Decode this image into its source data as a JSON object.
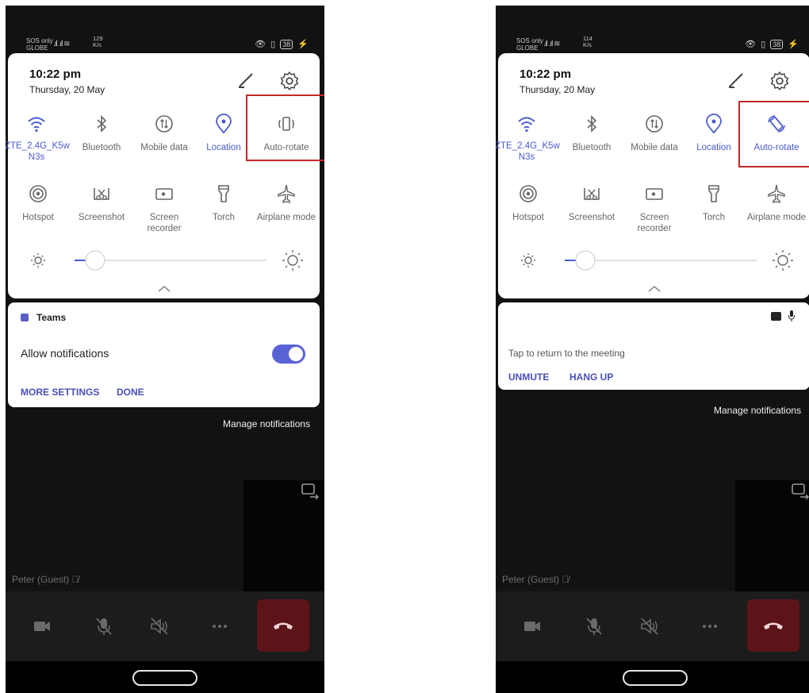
{
  "status_bar": {
    "sos": "SOS only",
    "carrier": "GLOBE",
    "left_speed": "129",
    "right_speed": "114",
    "speed_unit": "K/s",
    "battery": "38"
  },
  "quick_settings": {
    "time": "10:22 pm",
    "date": "Thursday, 20 May",
    "tiles": [
      {
        "label": "ZTE_2.4G_K5w N3s",
        "icon": "wifi-icon",
        "active": true
      },
      {
        "label": "Bluetooth",
        "icon": "bluetooth-icon",
        "active": false
      },
      {
        "label": "Mobile data",
        "icon": "mobile-data-icon",
        "active": false
      },
      {
        "label": "Location",
        "icon": "location-icon",
        "active": true
      },
      {
        "label": "Auto-rotate",
        "icon": "auto-rotate-icon",
        "active": false
      },
      {
        "label": "Hotspot",
        "icon": "hotspot-icon",
        "active": false
      },
      {
        "label": "Screenshot",
        "icon": "screenshot-icon",
        "active": false
      },
      {
        "label": "Screen recorder",
        "icon": "screen-recorder-icon",
        "active": false
      },
      {
        "label": "Torch",
        "icon": "torch-icon",
        "active": false
      },
      {
        "label": "Airplane mode",
        "icon": "airplane-icon",
        "active": false
      }
    ],
    "brightness": 0.1,
    "auto_rotate_active_right": true
  },
  "left_notification": {
    "app": "Teams",
    "allow_label": "Allow notifications",
    "allow_on": true,
    "more_settings": "MORE SETTINGS",
    "done": "DONE"
  },
  "right_notification": {
    "tap_text": "Tap to return to the meeting",
    "unmute": "UNMUTE",
    "hang_up": "HANG UP"
  },
  "manage_notifications": "Manage notifications",
  "guest_label": "Peter (Guest)",
  "colors": {
    "accent": "#4a5bd0",
    "highlight_box": "#c2282c",
    "hangup": "#5c1419"
  }
}
